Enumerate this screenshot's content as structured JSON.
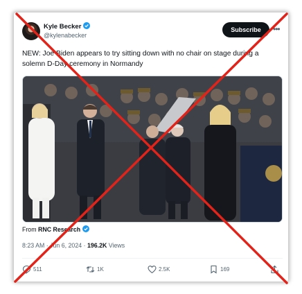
{
  "tweet": {
    "author_name": "Kyle Becker",
    "handle": "@kylenabecker",
    "subscribe_label": "Subscribe",
    "more_label": "•••",
    "text": "NEW: Joe Biden appears to try sitting down with no chair on stage during a solemn D-Day ceremony in Normandy",
    "from_prefix": "From",
    "from_source": "RNC Research",
    "time": "8:23 AM",
    "separator": "·",
    "date": "Jun 6, 2024",
    "views_count": "196.2K",
    "views_label": "Views"
  },
  "actions": {
    "replies": "511",
    "reposts": "1K",
    "likes": "2.5K",
    "bookmarks": "169"
  },
  "colors": {
    "verified": "#1d9bf0",
    "cross": "#e2231a",
    "subscribe_bg": "#0f1419",
    "text_secondary": "#536471"
  }
}
